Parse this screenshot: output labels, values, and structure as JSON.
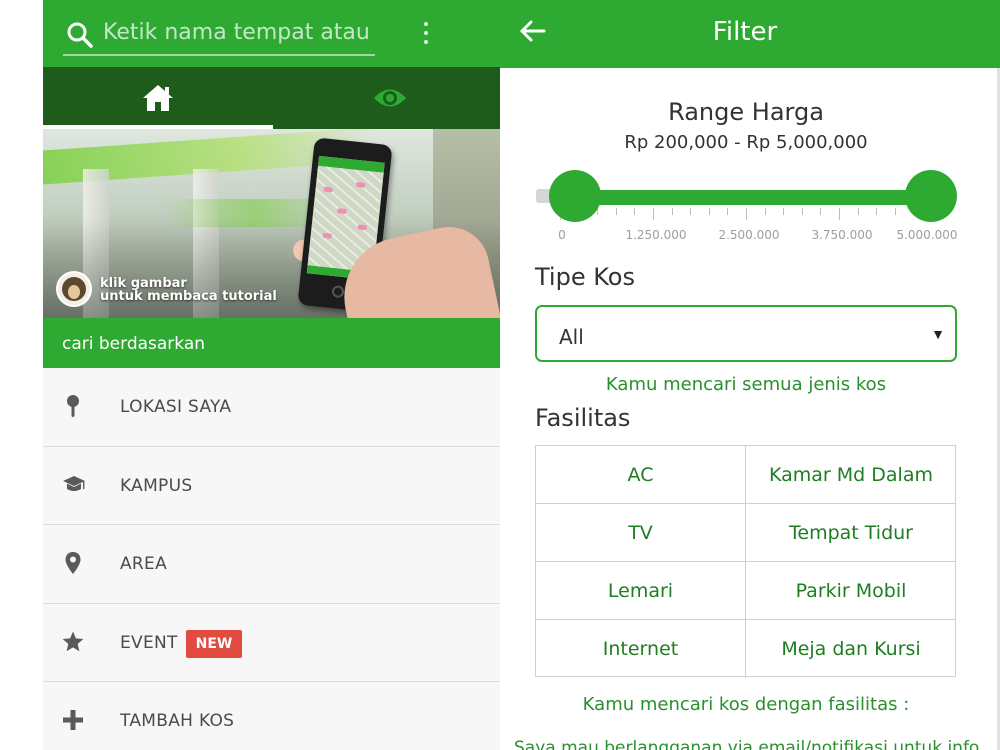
{
  "left_screen": {
    "search": {
      "placeholder": "Ketik nama tempat atau al"
    },
    "tabs": [
      {
        "icon": "home-icon",
        "active": true
      },
      {
        "icon": "eye-icon",
        "active": false
      }
    ],
    "banner": {
      "caption_line1": "klik gambar",
      "caption_line2": "untuk membaca tutorial"
    },
    "section_header": "cari berdasarkan",
    "menu": [
      {
        "label": "LOKASI SAYA",
        "icon": "pin-icon"
      },
      {
        "label": "KAMPUS",
        "icon": "graduation-cap-icon"
      },
      {
        "label": "AREA",
        "icon": "map-marker-icon"
      },
      {
        "label": "EVENT",
        "icon": "star-icon",
        "badge": "NEW"
      },
      {
        "label": "TAMBAH KOS",
        "icon": "plus-icon"
      }
    ]
  },
  "right_screen": {
    "title": "Filter",
    "price_range": {
      "title": "Range Harga",
      "value_text": "Rp 200,000 - Rp 5,000,000",
      "min": 0,
      "max": 5000000,
      "selected_min": 200000,
      "selected_max": 5000000,
      "tick_labels": [
        "0",
        "1.250.000",
        "2.500.000",
        "3.750.000",
        "5.000.000"
      ]
    },
    "tipe_kos": {
      "label": "Tipe Kos",
      "selected": "All",
      "hint": "Kamu mencari semua jenis kos"
    },
    "fasilitas": {
      "label": "Fasilitas",
      "items": [
        "AC",
        "Kamar Md Dalam",
        "TV",
        "Tempat Tidur",
        "Lemari",
        "Parkir Mobil",
        "Internet",
        "Meja dan Kursi"
      ],
      "hint": "Kamu mencari kos dengan fasilitas :"
    },
    "footer_text": "Saya mau berlangganan via email/notifikasi untuk info"
  },
  "colors": {
    "primary_green": "#2eaa33",
    "dark_green": "#1d5c1a",
    "text_green": "#2a8f2e",
    "badge_red": "#e24b3f"
  }
}
